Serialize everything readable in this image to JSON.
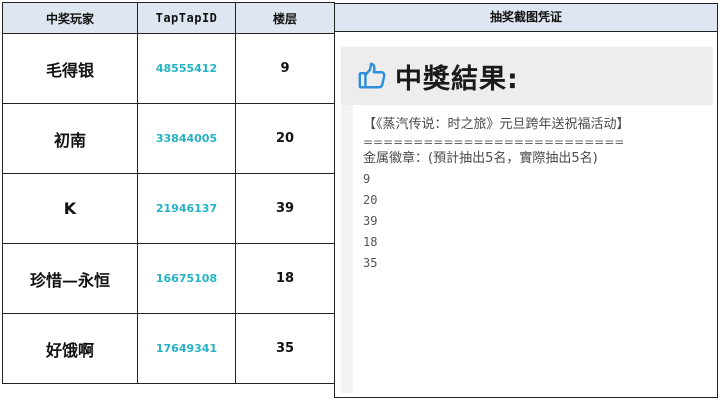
{
  "table": {
    "headers": {
      "winner": "中奖玩家",
      "taptap_id": "TapTapID",
      "floor": "楼层"
    },
    "rows": [
      {
        "name": "毛得银",
        "id": "48555412",
        "floor": "9"
      },
      {
        "name": "初南",
        "id": "33844005",
        "floor": "20"
      },
      {
        "name": "K",
        "id": "21946137",
        "floor": "39"
      },
      {
        "name": "珍惜—永恒",
        "id": "16675108",
        "floor": "18"
      },
      {
        "name": "好饿啊",
        "id": "17649341",
        "floor": "35"
      }
    ]
  },
  "proof": {
    "header": "抽奖截图凭证",
    "icon": "thumbs-up-icon",
    "title": "中獎結果:",
    "event": "【《蒸汽传说：时之旅》元旦跨年送祝福活动】",
    "separator": "==============================",
    "medal_line": "金属徽章：(預計抽出5名，實際抽出5名)",
    "floors": [
      "9",
      "20",
      "39",
      "18",
      "35"
    ]
  },
  "colors": {
    "header_bg": "#dde6f1",
    "id_text": "#24b3c4",
    "icon_blue": "#2f8fd8"
  }
}
